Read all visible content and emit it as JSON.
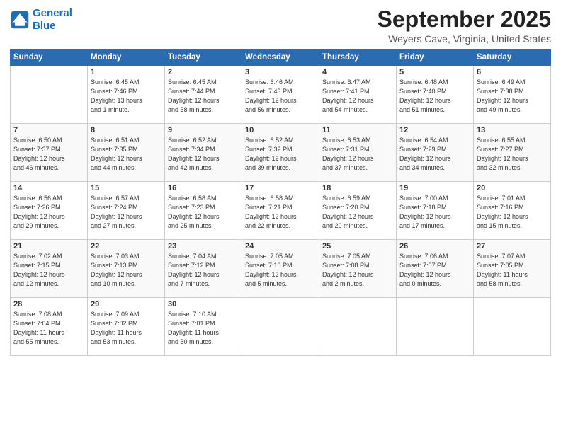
{
  "logo": {
    "line1": "General",
    "line2": "Blue"
  },
  "title": "September 2025",
  "subtitle": "Weyers Cave, Virginia, United States",
  "headers": [
    "Sunday",
    "Monday",
    "Tuesday",
    "Wednesday",
    "Thursday",
    "Friday",
    "Saturday"
  ],
  "weeks": [
    [
      {
        "day": "",
        "info": ""
      },
      {
        "day": "1",
        "info": "Sunrise: 6:45 AM\nSunset: 7:46 PM\nDaylight: 13 hours\nand 1 minute."
      },
      {
        "day": "2",
        "info": "Sunrise: 6:45 AM\nSunset: 7:44 PM\nDaylight: 12 hours\nand 58 minutes."
      },
      {
        "day": "3",
        "info": "Sunrise: 6:46 AM\nSunset: 7:43 PM\nDaylight: 12 hours\nand 56 minutes."
      },
      {
        "day": "4",
        "info": "Sunrise: 6:47 AM\nSunset: 7:41 PM\nDaylight: 12 hours\nand 54 minutes."
      },
      {
        "day": "5",
        "info": "Sunrise: 6:48 AM\nSunset: 7:40 PM\nDaylight: 12 hours\nand 51 minutes."
      },
      {
        "day": "6",
        "info": "Sunrise: 6:49 AM\nSunset: 7:38 PM\nDaylight: 12 hours\nand 49 minutes."
      }
    ],
    [
      {
        "day": "7",
        "info": "Sunrise: 6:50 AM\nSunset: 7:37 PM\nDaylight: 12 hours\nand 46 minutes."
      },
      {
        "day": "8",
        "info": "Sunrise: 6:51 AM\nSunset: 7:35 PM\nDaylight: 12 hours\nand 44 minutes."
      },
      {
        "day": "9",
        "info": "Sunrise: 6:52 AM\nSunset: 7:34 PM\nDaylight: 12 hours\nand 42 minutes."
      },
      {
        "day": "10",
        "info": "Sunrise: 6:52 AM\nSunset: 7:32 PM\nDaylight: 12 hours\nand 39 minutes."
      },
      {
        "day": "11",
        "info": "Sunrise: 6:53 AM\nSunset: 7:31 PM\nDaylight: 12 hours\nand 37 minutes."
      },
      {
        "day": "12",
        "info": "Sunrise: 6:54 AM\nSunset: 7:29 PM\nDaylight: 12 hours\nand 34 minutes."
      },
      {
        "day": "13",
        "info": "Sunrise: 6:55 AM\nSunset: 7:27 PM\nDaylight: 12 hours\nand 32 minutes."
      }
    ],
    [
      {
        "day": "14",
        "info": "Sunrise: 6:56 AM\nSunset: 7:26 PM\nDaylight: 12 hours\nand 29 minutes."
      },
      {
        "day": "15",
        "info": "Sunrise: 6:57 AM\nSunset: 7:24 PM\nDaylight: 12 hours\nand 27 minutes."
      },
      {
        "day": "16",
        "info": "Sunrise: 6:58 AM\nSunset: 7:23 PM\nDaylight: 12 hours\nand 25 minutes."
      },
      {
        "day": "17",
        "info": "Sunrise: 6:58 AM\nSunset: 7:21 PM\nDaylight: 12 hours\nand 22 minutes."
      },
      {
        "day": "18",
        "info": "Sunrise: 6:59 AM\nSunset: 7:20 PM\nDaylight: 12 hours\nand 20 minutes."
      },
      {
        "day": "19",
        "info": "Sunrise: 7:00 AM\nSunset: 7:18 PM\nDaylight: 12 hours\nand 17 minutes."
      },
      {
        "day": "20",
        "info": "Sunrise: 7:01 AM\nSunset: 7:16 PM\nDaylight: 12 hours\nand 15 minutes."
      }
    ],
    [
      {
        "day": "21",
        "info": "Sunrise: 7:02 AM\nSunset: 7:15 PM\nDaylight: 12 hours\nand 12 minutes."
      },
      {
        "day": "22",
        "info": "Sunrise: 7:03 AM\nSunset: 7:13 PM\nDaylight: 12 hours\nand 10 minutes."
      },
      {
        "day": "23",
        "info": "Sunrise: 7:04 AM\nSunset: 7:12 PM\nDaylight: 12 hours\nand 7 minutes."
      },
      {
        "day": "24",
        "info": "Sunrise: 7:05 AM\nSunset: 7:10 PM\nDaylight: 12 hours\nand 5 minutes."
      },
      {
        "day": "25",
        "info": "Sunrise: 7:05 AM\nSunset: 7:08 PM\nDaylight: 12 hours\nand 2 minutes."
      },
      {
        "day": "26",
        "info": "Sunrise: 7:06 AM\nSunset: 7:07 PM\nDaylight: 12 hours\nand 0 minutes."
      },
      {
        "day": "27",
        "info": "Sunrise: 7:07 AM\nSunset: 7:05 PM\nDaylight: 11 hours\nand 58 minutes."
      }
    ],
    [
      {
        "day": "28",
        "info": "Sunrise: 7:08 AM\nSunset: 7:04 PM\nDaylight: 11 hours\nand 55 minutes."
      },
      {
        "day": "29",
        "info": "Sunrise: 7:09 AM\nSunset: 7:02 PM\nDaylight: 11 hours\nand 53 minutes."
      },
      {
        "day": "30",
        "info": "Sunrise: 7:10 AM\nSunset: 7:01 PM\nDaylight: 11 hours\nand 50 minutes."
      },
      {
        "day": "",
        "info": ""
      },
      {
        "day": "",
        "info": ""
      },
      {
        "day": "",
        "info": ""
      },
      {
        "day": "",
        "info": ""
      }
    ]
  ]
}
